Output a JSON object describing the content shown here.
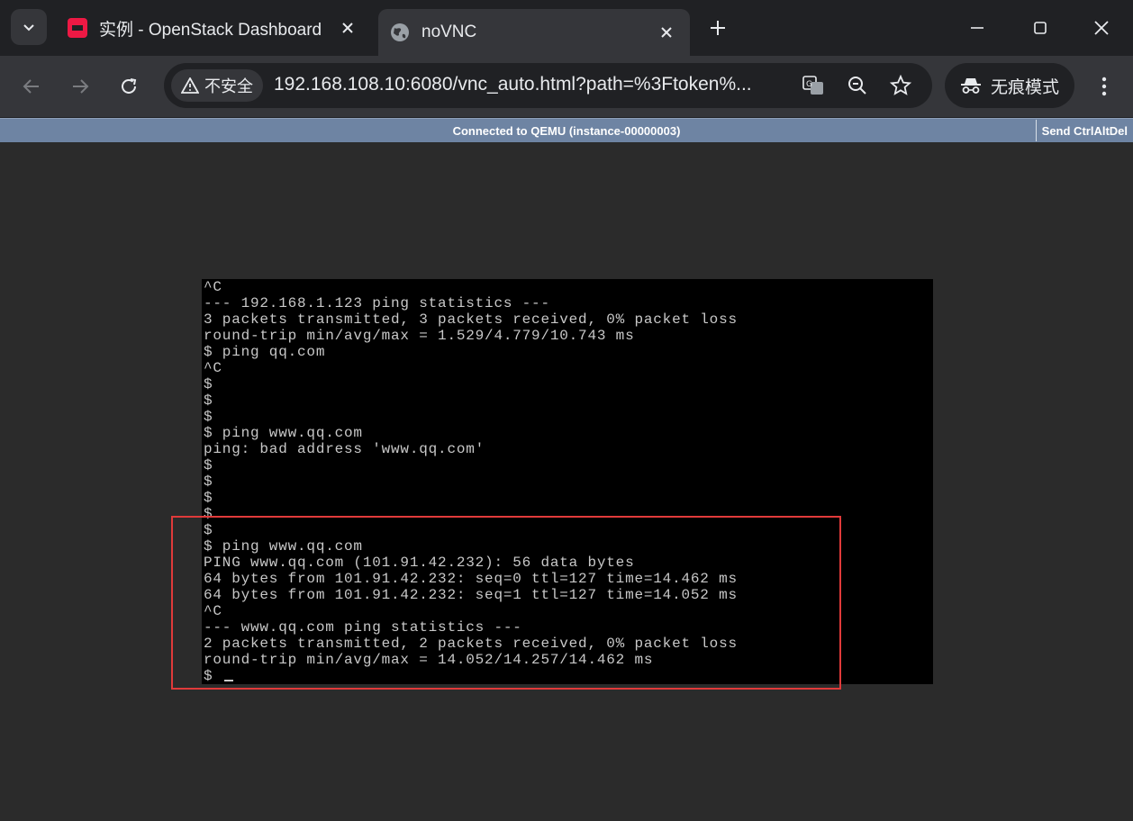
{
  "browser": {
    "tabs": [
      {
        "title": "实例 - OpenStack Dashboard",
        "active": false,
        "favicon": "openstack-icon"
      },
      {
        "title": "noVNC",
        "active": true,
        "favicon": "globe-icon"
      }
    ],
    "security_label": "不安全",
    "url": "192.168.108.10:6080/vnc_auto.html?path=%3Ftoken%...",
    "incognito_label": "无痕模式",
    "colors": {
      "frame": "#202124",
      "toolbar": "#35363a",
      "text": "#e8eaed"
    }
  },
  "vnc": {
    "status": "Connected to QEMU (instance-00000003)",
    "ctrl_alt_del_label": "Send CtrlAltDel",
    "bar_color": "#6e84a3"
  },
  "console": {
    "lines": [
      "^C",
      "--- 192.168.1.123 ping statistics ---",
      "3 packets transmitted, 3 packets received, 0% packet loss",
      "round-trip min/avg/max = 1.529/4.779/10.743 ms",
      "$ ping qq.com",
      "^C",
      "$",
      "$",
      "$",
      "$ ping www.qq.com",
      "ping: bad address 'www.qq.com'",
      "$",
      "$",
      "$",
      "$",
      "$",
      "$ ping www.qq.com",
      "PING www.qq.com (101.91.42.232): 56 data bytes",
      "64 bytes from 101.91.42.232: seq=0 ttl=127 time=14.462 ms",
      "64 bytes from 101.91.42.232: seq=1 ttl=127 time=14.052 ms",
      "^C",
      "--- www.qq.com ping statistics ---",
      "2 packets transmitted, 2 packets received, 0% packet loss",
      "round-trip min/avg/max = 14.052/14.257/14.462 ms",
      "$ "
    ],
    "highlight_color": "#e03a3a"
  }
}
